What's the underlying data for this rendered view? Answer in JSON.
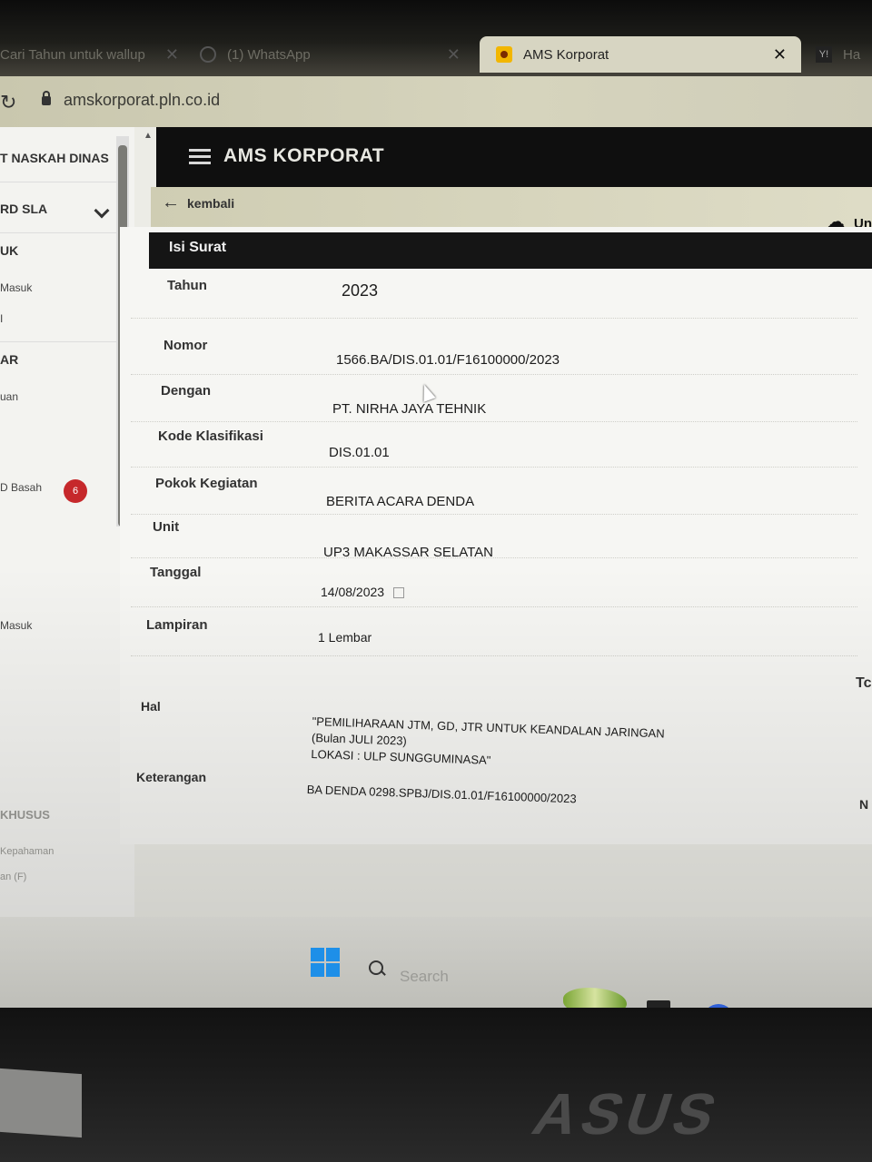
{
  "browser": {
    "tabs": [
      {
        "label": "Cari Tahun untuk wallup",
        "active": false
      },
      {
        "label": "(1) WhatsApp",
        "active": false
      },
      {
        "label": "AMS Korporat",
        "active": true
      },
      {
        "label": "Ha",
        "active": false
      }
    ],
    "url": "amskorporat.pln.co.id"
  },
  "sidebar": {
    "items": [
      {
        "label": "T NASKAH DINAS"
      },
      {
        "label": "RD SLA"
      },
      {
        "label": "UK"
      },
      {
        "label": "Masuk"
      },
      {
        "label": "I"
      },
      {
        "label": "AR"
      },
      {
        "label": "uan"
      },
      {
        "label": "D Basah"
      },
      {
        "label": "Masuk"
      },
      {
        "label": "KHUSUS"
      },
      {
        "label": "Kepahaman"
      },
      {
        "label": "an (F)"
      }
    ],
    "badge": "6"
  },
  "app": {
    "title": "AMS KORPORAT",
    "back_label": "kembali",
    "upload_label": "Un"
  },
  "form": {
    "section_title": "Isi Surat",
    "fields": [
      {
        "label": "Tahun",
        "value": "2023"
      },
      {
        "label": "Nomor",
        "value": "1566.BA/DIS.01.01/F16100000/2023"
      },
      {
        "label": "Dengan",
        "value": "PT. NIRHA JAYA TEHNIK"
      },
      {
        "label": "Kode Klasifikasi",
        "value": "DIS.01.01"
      },
      {
        "label": "Pokok Kegiatan",
        "value": "BERITA ACARA DENDA"
      },
      {
        "label": "Unit",
        "value": "UP3 MAKASSAR SELATAN"
      },
      {
        "label": "Tanggal",
        "value": "14/08/2023"
      },
      {
        "label": "Lampiran",
        "value": "1 Lembar"
      },
      {
        "label": "Hal",
        "value": "\"PEMILIHARAAN JTM, GD, JTR UNTUK KEANDALAN JARINGAN\n(Bulan JULI 2023)\nLOKASI : ULP SUNGGUMINASA\""
      },
      {
        "label": "Keterangan",
        "value": "BA DENDA 0298.SPBJ/DIS.01.01/F16100000/2023"
      }
    ],
    "right_clip_1": "Tc",
    "right_clip_2": "N"
  },
  "taskbar": {
    "search_placeholder": "Search"
  },
  "laptop": {
    "brand": "ASUS"
  }
}
